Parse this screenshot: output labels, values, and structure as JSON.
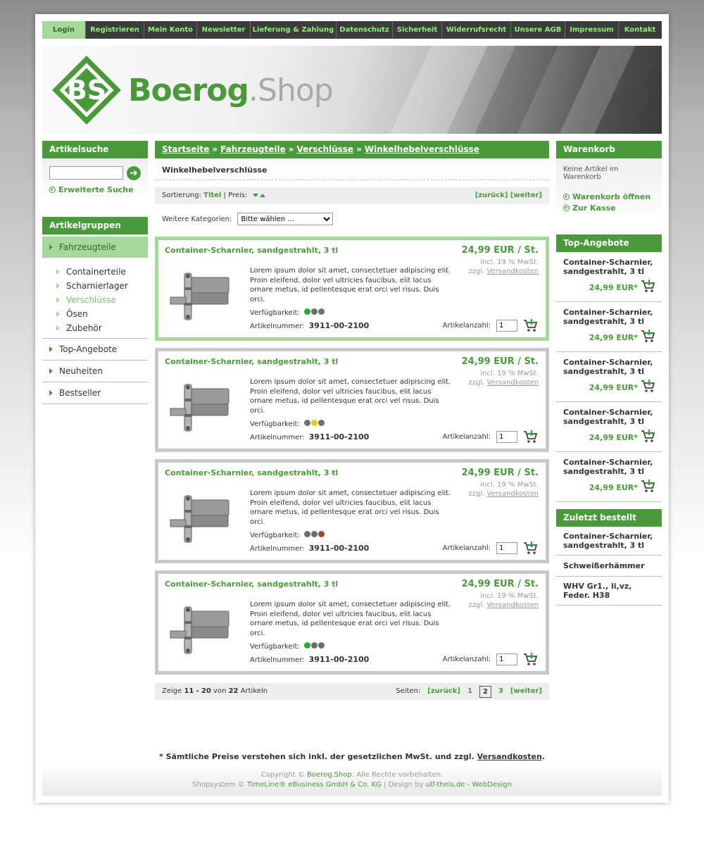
{
  "nav": [
    "Login",
    "Registrieren",
    "Mein Konto",
    "Newsletter",
    "Lieferung & Zahlung",
    "Datenschutz",
    "Sicherheit",
    "Widerrufsrecht",
    "Unsere AGB",
    "Impressum",
    "Kontakt"
  ],
  "logo": {
    "mark": "BS",
    "brand": "Boerog",
    "suffix": ".Shop"
  },
  "search": {
    "title": "Artikelsuche",
    "advanced": "Erweiterte Suche",
    "go": "➜"
  },
  "groups": {
    "title": "Artikelgruppen",
    "active": "Fahrzeugteile",
    "sub": [
      "Containerteile",
      "Scharnierlager",
      "Verschlüsse",
      "Ösen",
      "Zubehör"
    ],
    "sub_active_index": 2,
    "others": [
      "Top-Angebote",
      "Neuheiten",
      "Bestseller"
    ]
  },
  "breadcrumb": {
    "items": [
      "Startseite",
      "Fahrzeugteile",
      "Verschlüsse",
      "Winkelhebelverschlüsse"
    ],
    "sep": "»"
  },
  "page_title": "Winkelhebelverschlüsse",
  "sorting": {
    "label": "Sortierung:",
    "title": "Titel",
    "price": "Preis:",
    "back": "[zurück]",
    "next": "[weiter]"
  },
  "more_categories": {
    "label": "Weitere Kategorien:",
    "selected": "Bitte wählen ..."
  },
  "products": [
    {
      "name": "Container-Scharnier, sandgestrahlt, 3 tl",
      "price": "24,99 EUR / St.",
      "tax": "incl. 19 % MwSt.",
      "shipping_prefix": "zzgl.",
      "shipping": "Versandkosten",
      "desc": "Lorem ipsum dolor sit amet, consectetuer adipiscing elit. Proin eleifend, dolor vel ultricies faucibus, elit lacus ornare metus, id pellentesque erat orci vel risus. Duis orci.",
      "avail_label": "Verfügbarkeit:",
      "avail": "green",
      "artnr_label": "Artikelnummer:",
      "artnr": "3911-00-2100",
      "qty_label": "Artikelanzahl:",
      "qty": "1"
    },
    {
      "name": "Container-Scharnier, sandgestrahlt, 3 tl",
      "price": "24,99 EUR / St.",
      "tax": "incl. 19 % MwSt.",
      "shipping_prefix": "zzgl.",
      "shipping": "Versandkosten",
      "desc": "Lorem ipsum dolor sit amet, consectetuer adipiscing elit. Proin eleifend, dolor vel ultricies faucibus, elit lacus ornare metus, id pellentesque erat orci vel risus. Duis orci.",
      "avail_label": "Verfügbarkeit:",
      "avail": "yellow",
      "artnr_label": "Artikelnummer:",
      "artnr": "3911-00-2100",
      "qty_label": "Artikelanzahl:",
      "qty": "1"
    },
    {
      "name": "Container-Scharnier, sandgestrahlt, 3 tl",
      "price": "24,99 EUR / St.",
      "tax": "incl. 19 % MwSt.",
      "shipping_prefix": "zzgl.",
      "shipping": "Versandkosten",
      "desc": "Lorem ipsum dolor sit amet, consectetuer adipiscing elit. Proin eleifend, dolor vel ultricies faucibus, elit lacus ornare metus, id pellentesque erat orci vel risus. Duis orci.",
      "avail_label": "Verfügbarkeit:",
      "avail": "red",
      "artnr_label": "Artikelnummer:",
      "artnr": "3911-00-2100",
      "qty_label": "Artikelanzahl:",
      "qty": "1"
    },
    {
      "name": "Container-Scharnier, sandgestrahlt, 3 tl",
      "price": "24,99 EUR / St.",
      "tax": "incl. 19 % MwSt.",
      "shipping_prefix": "zzgl.",
      "shipping": "Versandkosten",
      "desc": "Lorem ipsum dolor sit amet, consectetuer adipiscing elit. Proin eleifend, dolor vel ultricies faucibus, elit lacus ornare metus, id pellentesque erat orci vel risus. Duis orci.",
      "avail_label": "Verfügbarkeit:",
      "avail": "green",
      "artnr_label": "Artikelnummer:",
      "artnr": "3911-00-2100",
      "qty_label": "Artikelanzahl:",
      "qty": "1"
    }
  ],
  "pager": {
    "show": "Zeige",
    "from": "11",
    "dash": "-",
    "to": "20",
    "of": "von",
    "total": "22",
    "items": "Artikeln",
    "pages_label": "Seiten:",
    "back": "[zurück]",
    "pages": [
      "1",
      "2",
      "3"
    ],
    "current": "2",
    "next": "[weiter]"
  },
  "cart": {
    "title": "Warenkorb",
    "empty": "Keine Artikel im Warenkorb",
    "open": "Warenkorb öffnen",
    "checkout": "Zur Kasse"
  },
  "top_offers": {
    "title": "Top-Angebote",
    "items": [
      {
        "name": "Container-Scharnier, sandgestrahlt, 3 tl",
        "price": "24,99 EUR*"
      },
      {
        "name": "Container-Scharnier, sandgestrahlt, 3 tl",
        "price": "24,99 EUR*"
      },
      {
        "name": "Container-Scharnier, sandgestrahlt, 3 tl",
        "price": "24,99 EUR*"
      },
      {
        "name": "Container-Scharnier, sandgestrahlt, 3 tl",
        "price": "24,99 EUR*"
      },
      {
        "name": "Container-Scharnier, sandgestrahlt, 3 tl",
        "price": "24,99 EUR*"
      }
    ]
  },
  "last_ordered": {
    "title": "Zuletzt bestellt",
    "items": [
      "Container-Scharnier, sandgestrahlt, 3 tl",
      "Schweißerhämmer",
      "WHV Gr1., li,vz, Feder. H38"
    ]
  },
  "footnote": {
    "text": "* Sämtliche Preise verstehen sich inkl. der gesetzlichen MwSt. und zzgl.",
    "link": "Versandkosten",
    "end": "."
  },
  "footer": {
    "copy": "Copyright ©",
    "brand": "Boerog.Shop",
    "rights": ". Alle Rechte vorbehalten.",
    "shopsystem": "Shopsystem ©",
    "vendor": "TimeLine® eBusiness GmbH & Co. KG",
    "design": "| Design by",
    "designer": "ulf-theis.de - WebDesign"
  },
  "colors": {
    "brand_green": "#4a9a3c",
    "light_green": "#a5d89a",
    "nav_bg": "#3c3c3c",
    "nav_text": "#8ff07a"
  }
}
